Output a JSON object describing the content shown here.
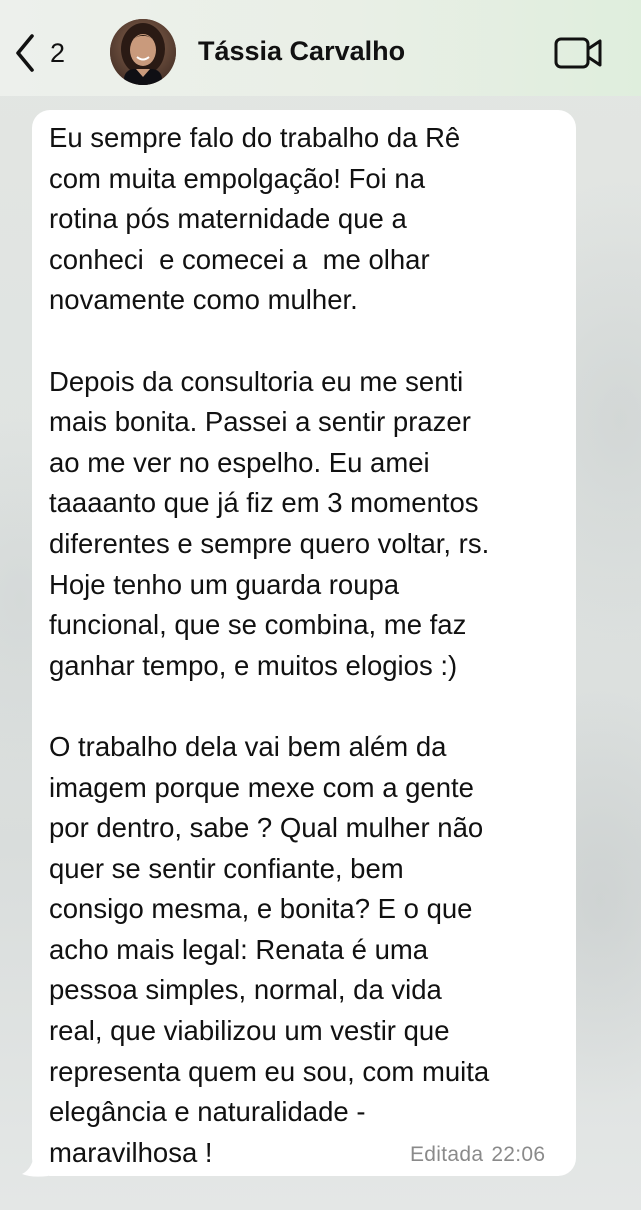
{
  "header": {
    "back_icon": "chevron-left-icon",
    "unread_count": "2",
    "contact_name": "Tássia Carvalho",
    "avatar_icon": "contact-avatar",
    "video_icon": "video-camera-icon"
  },
  "message": {
    "text": "Eu sempre falo do trabalho da Rê\ncom muita empolgação! Foi na\nrotina pós maternidade que a\nconheci  e comecei a  me olhar\nnovamente como mulher.\n\nDepois da consultoria eu me senti\nmais bonita. Passei a sentir prazer\nao me ver no espelho. Eu amei\ntaaaanto que já fiz em 3 momentos\ndiferentes e sempre quero voltar, rs.\nHoje tenho um guarda roupa\nfuncional, que se combina, me faz\nganhar tempo, e muitos elogios :)\n\nO trabalho dela vai bem além da\nimagem porque mexe com a gente\npor dentro, sabe ? Qual mulher não\nquer se sentir confiante, bem\nconsigo mesma, e bonita? E o que\nacho mais legal: Renata é uma\npessoa simples, normal, da vida\nreal, que viabilizou um vestir que\nrepresenta quem eu sou, com muita\nelegância e naturalidade -\nmaravilhosa !",
    "edited_label": "Editada",
    "time": "22:06"
  },
  "colors": {
    "header_bg": "#e9efe6",
    "bubble_bg": "#ffffff",
    "meta_text": "#8a8a8a"
  }
}
